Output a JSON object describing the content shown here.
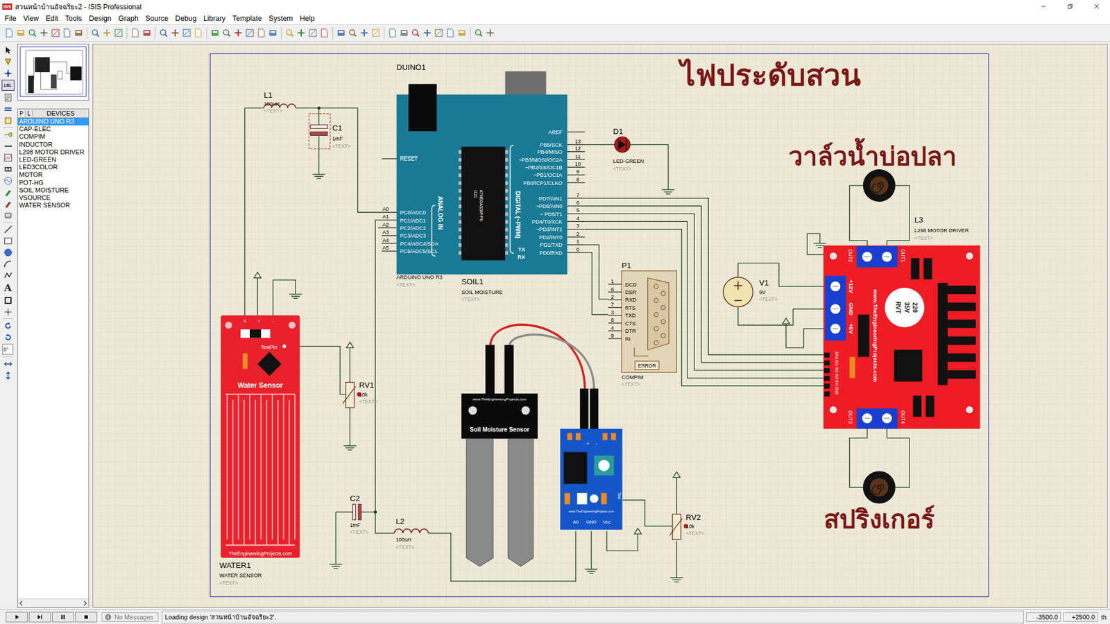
{
  "window": {
    "title": "สวนหน้าบ้านอัจฉริยะ2 - ISIS Professional",
    "app_badge": "ISIS"
  },
  "menu": [
    "File",
    "View",
    "Edit",
    "Tools",
    "Design",
    "Graph",
    "Source",
    "Debug",
    "Library",
    "Template",
    "System",
    "Help"
  ],
  "left_tools": {
    "label_tool": "LBL",
    "text_tool": "A",
    "rotation": "0°"
  },
  "sidebar": {
    "tabs": [
      {
        "label": "P",
        "selected": true
      },
      {
        "label": "L",
        "selected": false
      }
    ],
    "header": "DEVICES",
    "items": [
      {
        "label": "ARDUINO UNO R3",
        "selected": true
      },
      {
        "label": "CAP-ELEC",
        "selected": false
      },
      {
        "label": "COMPIM",
        "selected": false
      },
      {
        "label": "INDUCTOR",
        "selected": false
      },
      {
        "label": "L298 MOTOR DRIVER",
        "selected": false
      },
      {
        "label": "LED-GREEN",
        "selected": false
      },
      {
        "label": "LED3COLOR",
        "selected": false
      },
      {
        "label": "MOTOR",
        "selected": false
      },
      {
        "label": "POT-HG",
        "selected": false
      },
      {
        "label": "SOIL MOISTURE",
        "selected": false
      },
      {
        "label": "VSOURCE",
        "selected": false
      },
      {
        "label": "WATER SENSOR",
        "selected": false
      }
    ]
  },
  "schematic": {
    "title": "ไฟประดับสวน",
    "valve_label": "วาล์วน้ำบ่อปลา",
    "sprinkler_label": "สปริงเกอร์",
    "duino1": {
      "ref": "DUINO1",
      "name": "ARDUINO UNO R3",
      "text": "<TEXT>",
      "chip": "ATMEGA328P-PU",
      "chip_code": "1121",
      "analog_caption": "ANALOG IN",
      "digital_caption": "DIGITAL (~PWM)",
      "reset": "RESET",
      "aref": "AREF",
      "tx": "TX",
      "rx": "RX",
      "digital_pins": [
        {
          "label": "PB5/SCK",
          "num": "13"
        },
        {
          "label": "PB4/MISO",
          "num": "12"
        },
        {
          "label": "~PB3/MOSI/OC2A",
          "num": "11"
        },
        {
          "label": "~PB2/SS/OC1B",
          "num": "10"
        },
        {
          "label": "~PB1/OC1A",
          "num": "9"
        },
        {
          "label": "PB0/ICP1/CLKO",
          "num": "8"
        },
        {
          "label": "PD7/AIN1",
          "num": "7"
        },
        {
          "label": "~PD6/AIN0",
          "num": "6"
        },
        {
          "label": "~ PD5/T1",
          "num": "5"
        },
        {
          "label": "PD4/T0/XCK",
          "num": "4"
        },
        {
          "label": "~PD3/INT1",
          "num": "3"
        },
        {
          "label": "PD2/INT0",
          "num": "2"
        },
        {
          "label": "PD1/TXD",
          "num": "1"
        },
        {
          "label": "PD0/RXD",
          "num": "0"
        }
      ],
      "analog_pins": [
        {
          "label": "PC0/ADC0",
          "num": "A0"
        },
        {
          "label": "PC1/ADC1",
          "num": "A1"
        },
        {
          "label": "PC2/ADC2",
          "num": "A2"
        },
        {
          "label": "PC3/ADC3",
          "num": "A3"
        },
        {
          "label": "PC4/ADC4/SDA",
          "num": "A4"
        },
        {
          "label": "PC5/ADC5/SCL",
          "num": "A5"
        }
      ]
    },
    "soil1": {
      "ref": "SOIL1",
      "name": "SOIL MOISTURE",
      "text": "<TEXT>",
      "probe_site": "www.TheEngineeringProjects.com",
      "probe_title": "Soil Moisture Sensor",
      "plus": "+",
      "minus": "-",
      "module_site": "www.TheEngineeringProjects.com",
      "test": "Test",
      "pins": [
        "A0",
        "GND",
        "Vcc"
      ]
    },
    "l1": {
      "ref": "L1",
      "value": "100uH",
      "text": "<TEXT>"
    },
    "c1": {
      "ref": "C1",
      "value": "1mF",
      "text": "<TEXT>"
    },
    "d1": {
      "ref": "D1",
      "value": "LED-GREEN",
      "text": "<TEXT>"
    },
    "rv1": {
      "ref": "RV1",
      "value": "10k",
      "text": "<TEXT>"
    },
    "c2": {
      "ref": "C2",
      "value": "1mF",
      "text": "<TEXT>"
    },
    "l2": {
      "ref": "L2",
      "value": "100uH",
      "text": "<TEXT>"
    },
    "rv2": {
      "ref": "RV2",
      "value": "10k",
      "text": "<TEXT>"
    },
    "v1": {
      "ref": "V1",
      "value": "9V",
      "text": "<TEXT>"
    },
    "p1": {
      "ref": "P1",
      "name": "COMPIM",
      "text": "<TEXT>",
      "error": "ERROR",
      "pins": [
        {
          "num": "1",
          "label": "DCD"
        },
        {
          "num": "6",
          "label": "DSR"
        },
        {
          "num": "2",
          "label": "RXD"
        },
        {
          "num": "7",
          "label": "RTS"
        },
        {
          "num": "3",
          "label": "TXD"
        },
        {
          "num": "8",
          "label": "CTS"
        },
        {
          "num": "4",
          "label": "DTR"
        },
        {
          "num": "9",
          "label": "RI"
        }
      ]
    },
    "water1": {
      "ref": "WATER1",
      "name": "WATER SENSOR",
      "text": "<TEXT>",
      "pin_s": "S",
      "pin_plus": "+",
      "pin_minus": "-",
      "test_pin": "TestPin",
      "title": "Water Sensor",
      "site": "TheEngineeringProjects.com"
    },
    "l3": {
      "ref": "L3",
      "name": "L298 MOTOR DRIVER",
      "text": "<TEXT>",
      "out2": "OUT2",
      "out1": "OUT1",
      "out3": "OUT3",
      "out4": "OUT4",
      "power": [
        "+12V",
        "GND",
        "+5V"
      ],
      "site": "www.TheEngineeringProjects.com",
      "cap": [
        "220",
        "35V",
        "RVT"
      ],
      "inputs": "ENA IN1 IN2 IN3 IN4 ENB"
    }
  },
  "status_bar": {
    "messages": "No Messages",
    "status": "Loading design 'สวนหน้าบ้านอัจฉริยะ2'.",
    "x": "-3500.0",
    "y": "+2500.0",
    "units": "th"
  }
}
